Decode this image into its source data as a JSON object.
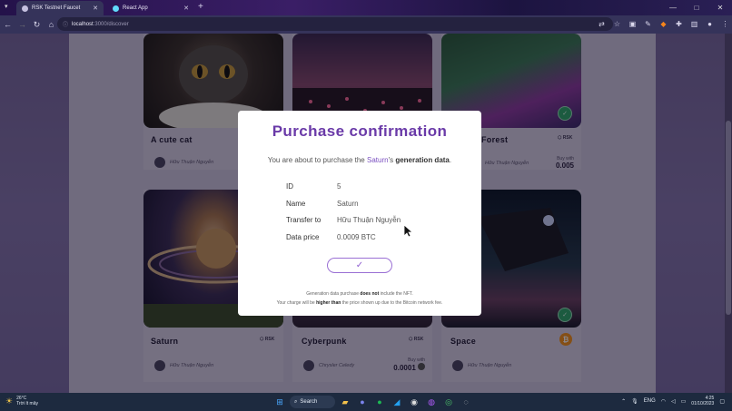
{
  "browser": {
    "tabs": [
      {
        "label": "RSK Testnet Faucet",
        "active": true
      },
      {
        "label": "React App",
        "active": false
      }
    ],
    "new_tab": "+",
    "url_host": "localhost",
    "url_path": ":3000/discover"
  },
  "cards": [
    {
      "title": "A cute cat",
      "author": "Hữu Thuận Nguyễn"
    },
    {
      "title": "",
      "author": ""
    },
    {
      "title": "Forest",
      "author": "Hữu Thuận Nguyễn",
      "chain": "RSK",
      "buy_with": "Buy with",
      "price": "0.005"
    },
    {
      "title": "Saturn",
      "author": "Hữu Thuận Nguyễn",
      "chain": "RSK"
    },
    {
      "title": "Cyberpunk",
      "author": "Chrysler Celedy",
      "chain": "RSK",
      "buy_with": "Buy with",
      "price": "0.0001"
    },
    {
      "title": "Space",
      "author": "Hữu Thuận Nguyễn"
    }
  ],
  "modal": {
    "title": "Purchase confirmation",
    "lead_before": "You are about to purchase the ",
    "lead_name": "Saturn",
    "lead_after": "'s ",
    "lead_bold": "generation data",
    "lead_end": ".",
    "rows": [
      {
        "key": "ID",
        "value": "5"
      },
      {
        "key": "Name",
        "value": "Saturn"
      },
      {
        "key": "Transfer to",
        "value": "Hữu Thuận Nguyễn"
      },
      {
        "key": "Data price",
        "value": "0.0009 BTC"
      }
    ],
    "confirm_symbol": "✓",
    "note1_a": "Generation data purchase ",
    "note1_b": "does not",
    "note1_c": " include the NFT.",
    "note2_a": "Your charge will be ",
    "note2_b": "higher than",
    "note2_c": " the price shown up due to the Bitcoin network fee."
  },
  "taskbar": {
    "temp": "26°C",
    "weather": "Trời ít mây",
    "search": "Search",
    "lang": "ENG",
    "time": "4:25",
    "date": "01/10/2023"
  }
}
